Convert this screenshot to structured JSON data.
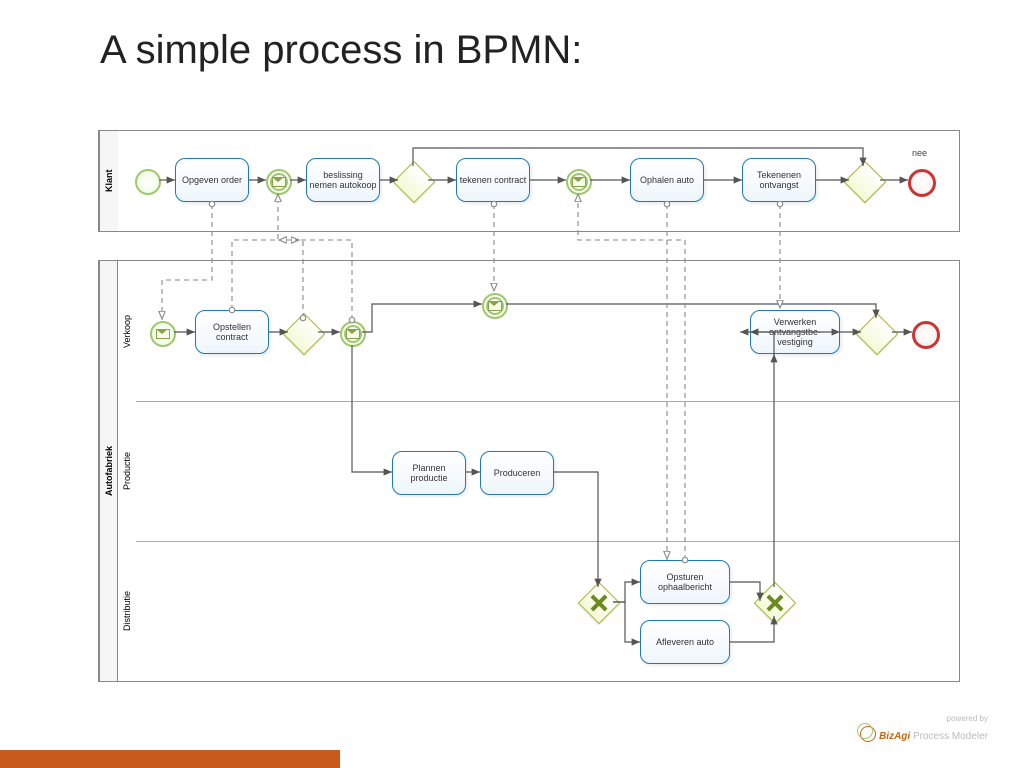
{
  "title": "A simple process in BPMN:",
  "pools": {
    "klant": {
      "label": "Klant"
    },
    "autofabriek": {
      "label": "Autofabriek",
      "lanes": {
        "verkoop": "Verkoop",
        "productie": "Productie",
        "distributie": "Distributie"
      }
    }
  },
  "tasks": {
    "opgeven_order": "Opgeven order",
    "beslissing": "beslissing nemen autokoop",
    "tekenen_contract": "tekenen contract",
    "ophalen_auto": "Ophalen auto",
    "tekenen_ontvangst": "Tekenenen ontvangst",
    "opstellen_contract": "Opstellen contract",
    "verwerken": "Verwerken ontvangstbe- vestiging",
    "plannen": "Plannen productie",
    "produceren": "Produceren",
    "opsturen": "Opsturen ophaalbericht",
    "afleveren": "Afleveren auto"
  },
  "labels": {
    "nee": "nee"
  },
  "brand": {
    "powered": "powered by",
    "biz": "BizAgi",
    "pm": "Process Modeler"
  }
}
